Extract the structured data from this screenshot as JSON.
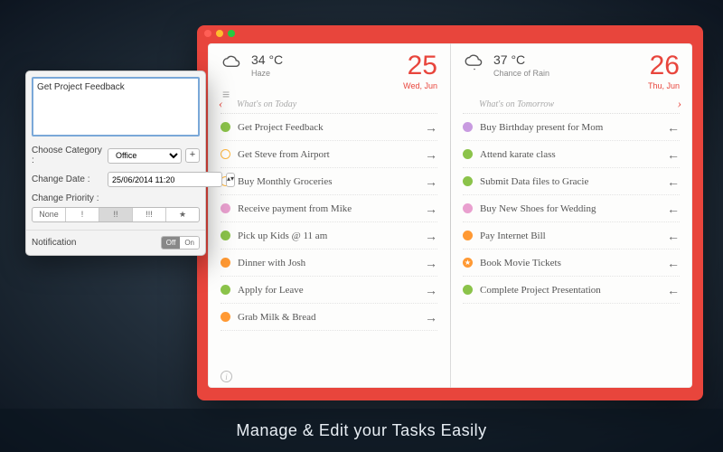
{
  "caption": "Manage & Edit your Tasks Easily",
  "planner": {
    "left": {
      "temp": "34 °C",
      "condition": "Haze",
      "dateNum": "25",
      "dateLabel": "Wed, Jun",
      "header": "What's on Today",
      "tasks": [
        {
          "label": "Get Project Feedback",
          "color": "#8bc34a"
        },
        {
          "label": "Get Steve from Airport",
          "color": "#ffffff",
          "ring": true
        },
        {
          "label": "Buy Monthly Groceries",
          "color": "#ffffff",
          "ring": true
        },
        {
          "label": "Receive payment from Mike",
          "color": "#e9a0cf"
        },
        {
          "label": "Pick up Kids @ 11 am",
          "color": "#8bc34a"
        },
        {
          "label": "Dinner with Josh",
          "color": "#ff9933"
        },
        {
          "label": "Apply for Leave",
          "color": "#8bc34a"
        },
        {
          "label": "Grab Milk & Bread",
          "color": "#ff9933"
        }
      ]
    },
    "right": {
      "temp": "37 °C",
      "condition": "Chance of Rain",
      "dateNum": "26",
      "dateLabel": "Thu, Jun",
      "header": "What's on Tomorrow",
      "tasks": [
        {
          "label": "Buy Birthday present for Mom",
          "color": "#c89be0"
        },
        {
          "label": "Attend karate class",
          "color": "#8bc34a"
        },
        {
          "label": "Submit Data files to Gracie",
          "color": "#8bc34a"
        },
        {
          "label": "Buy New Shoes for Wedding",
          "color": "#e9a0cf"
        },
        {
          "label": "Pay Internet Bill",
          "color": "#ff9933"
        },
        {
          "label": "Book Movie Tickets",
          "color": "#ff9933",
          "star": true
        },
        {
          "label": "Complete Project Presentation",
          "color": "#8bc34a"
        }
      ]
    }
  },
  "editPanel": {
    "text": "Get Project Feedback",
    "categoryLabel": "Choose Category :",
    "categoryValue": "Office",
    "dateLabel": "Change Date :",
    "dateValue": "25/06/2014 11:20",
    "priorityLabel": "Change Priority :",
    "priorities": [
      "None",
      "!",
      "!!",
      "!!!",
      "★"
    ],
    "priorityActive": 2,
    "notificationLabel": "Notification",
    "toggleOff": "Off",
    "toggleOn": "On"
  }
}
